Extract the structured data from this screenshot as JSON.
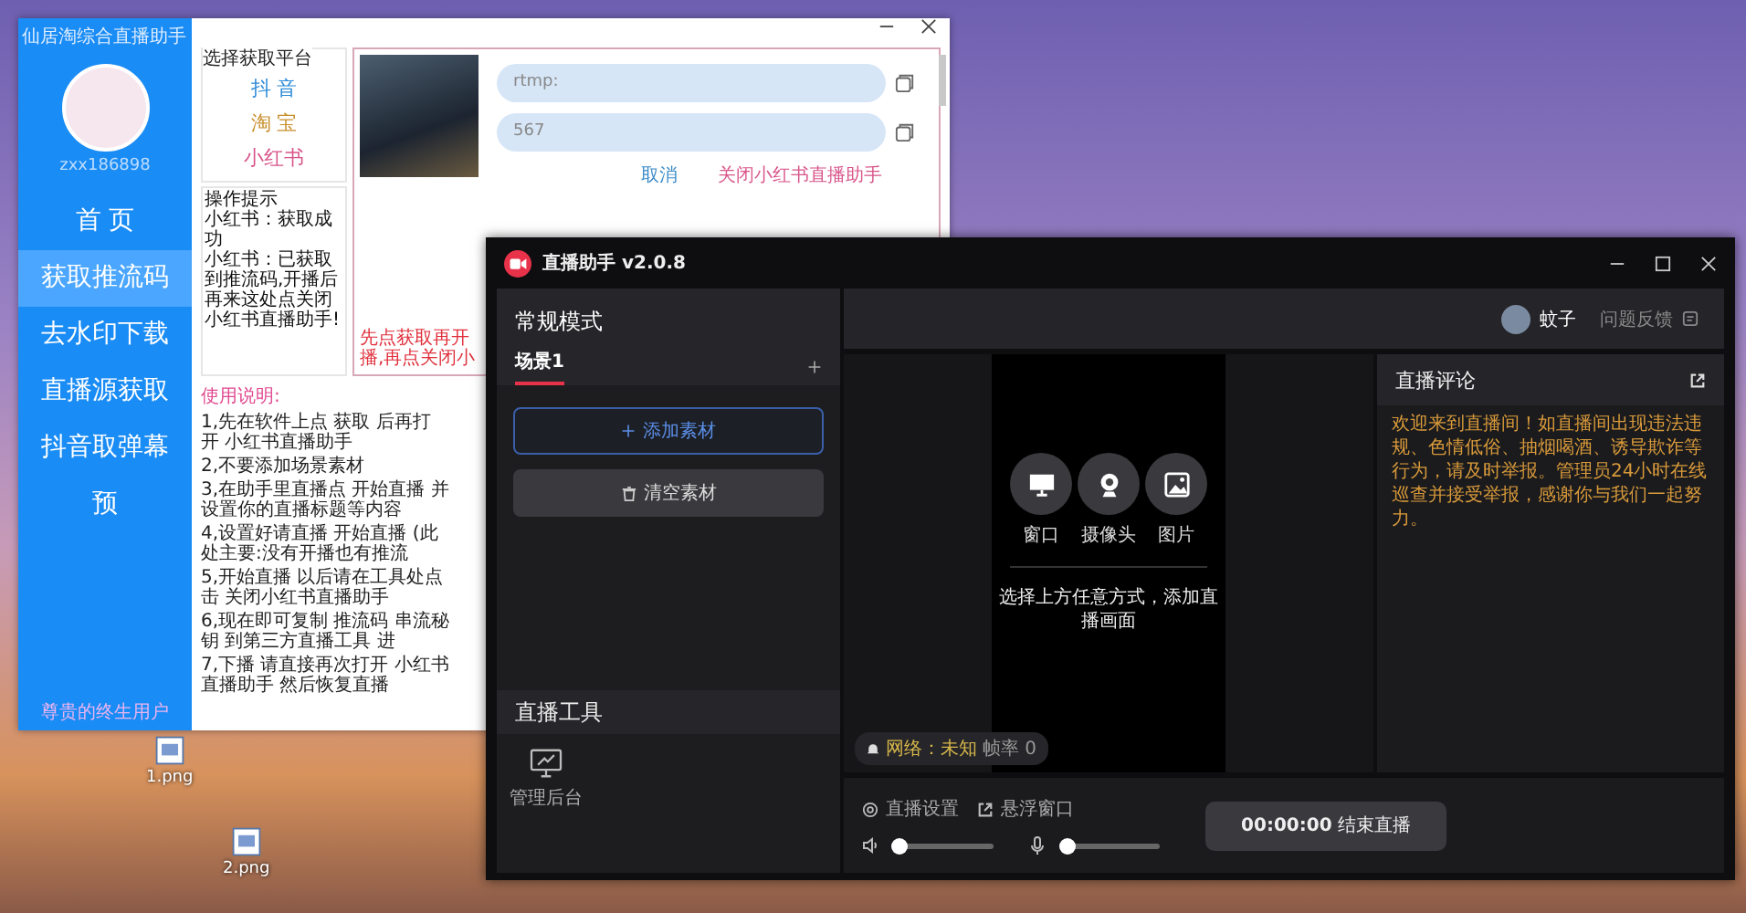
{
  "desktop": {
    "files": [
      {
        "name": "1.png"
      },
      {
        "name": "2.png"
      }
    ]
  },
  "helper_window": {
    "title": "仙居淘综合直播助手",
    "username": "zxx186898",
    "nav": [
      {
        "label": "首 页",
        "selected": false
      },
      {
        "label": "获取推流码",
        "selected": true
      },
      {
        "label": "去水印下载",
        "selected": false
      },
      {
        "label": "直播源获取",
        "selected": false
      },
      {
        "label": "抖音取弹幕",
        "selected": false
      },
      {
        "label": "预",
        "selected": false
      }
    ],
    "footer": "尊贵的终生用户",
    "platform_group": {
      "title": "选择获取平台",
      "platforms": [
        {
          "label": "抖 音",
          "color": "#2e8bd8"
        },
        {
          "label": "淘 宝",
          "color": "#c8902e"
        },
        {
          "label": "小红书",
          "color": "#d9558a"
        }
      ]
    },
    "tips": {
      "title": "操作提示",
      "lines": [
        "小红书：获取成功",
        "小红书：已获取到推流码,开播后再来这处点关闭小红书直播助手!"
      ]
    },
    "stream_fields": [
      {
        "value": "rtmp:"
      },
      {
        "value": "567"
      }
    ],
    "actions": [
      {
        "label": "取消",
        "kind": "cancel"
      },
      {
        "label": "关闭小红书直播助手",
        "kind": "close"
      }
    ],
    "warning": "先点获取再开播,再点关闭小",
    "instructions": {
      "title": "使用说明:",
      "items": [
        "1,先在软件上点 获取 后再打开 小红书直播助手",
        "2,不要添加场景素材",
        "3,在助手里直播点 开始直播 并设置你的直播标题等内容",
        "4,设置好请直播 开始直播 (此处主要:没有开播也有推流",
        "5,开始直播 以后请在工具处点击 关闭小红书直播助手",
        "6,现在即可复制 推流码 串流秘钥 到第三方直播工具 进",
        "7,下播 请直接再次打开 小红书直播助手 然后恢复直播"
      ]
    }
  },
  "live_window": {
    "title": "直播助手 v2.0.8",
    "mode_title": "常规模式",
    "scenes": [
      {
        "label": "场景1",
        "selected": true
      }
    ],
    "add_button": "添加素材",
    "clear_button": "清空素材",
    "tools_title": "直播工具",
    "tools": [
      {
        "label": "管理后台"
      }
    ],
    "user": {
      "name": "蚊子"
    },
    "feedback": "问题反馈",
    "sources": [
      {
        "label": "窗口",
        "kind": "monitor"
      },
      {
        "label": "摄像头",
        "kind": "camera"
      },
      {
        "label": "图片",
        "kind": "image"
      }
    ],
    "preview_hint": "选择上方任意方式，添加直播画面",
    "network": {
      "label": "网络：未知",
      "fps": "帧率 0"
    },
    "comments": {
      "title": "直播评论",
      "notice": "欢迎来到直播间！如直播间出现违法违规、色情低俗、抽烟喝酒、诱导欺诈等行为，请及时举报。管理员24小时在线巡查并接受举报，感谢你与我们一起努力。"
    },
    "settings": [
      {
        "label": "直播设置",
        "kind": "gear"
      },
      {
        "label": "悬浮窗口",
        "kind": "popout"
      }
    ],
    "volumes": [
      {
        "kind": "speaker",
        "level": 0.03
      },
      {
        "kind": "mic",
        "level": 0.06
      }
    ],
    "end_button": {
      "time": "00:00:00",
      "label": "结束直播"
    }
  }
}
